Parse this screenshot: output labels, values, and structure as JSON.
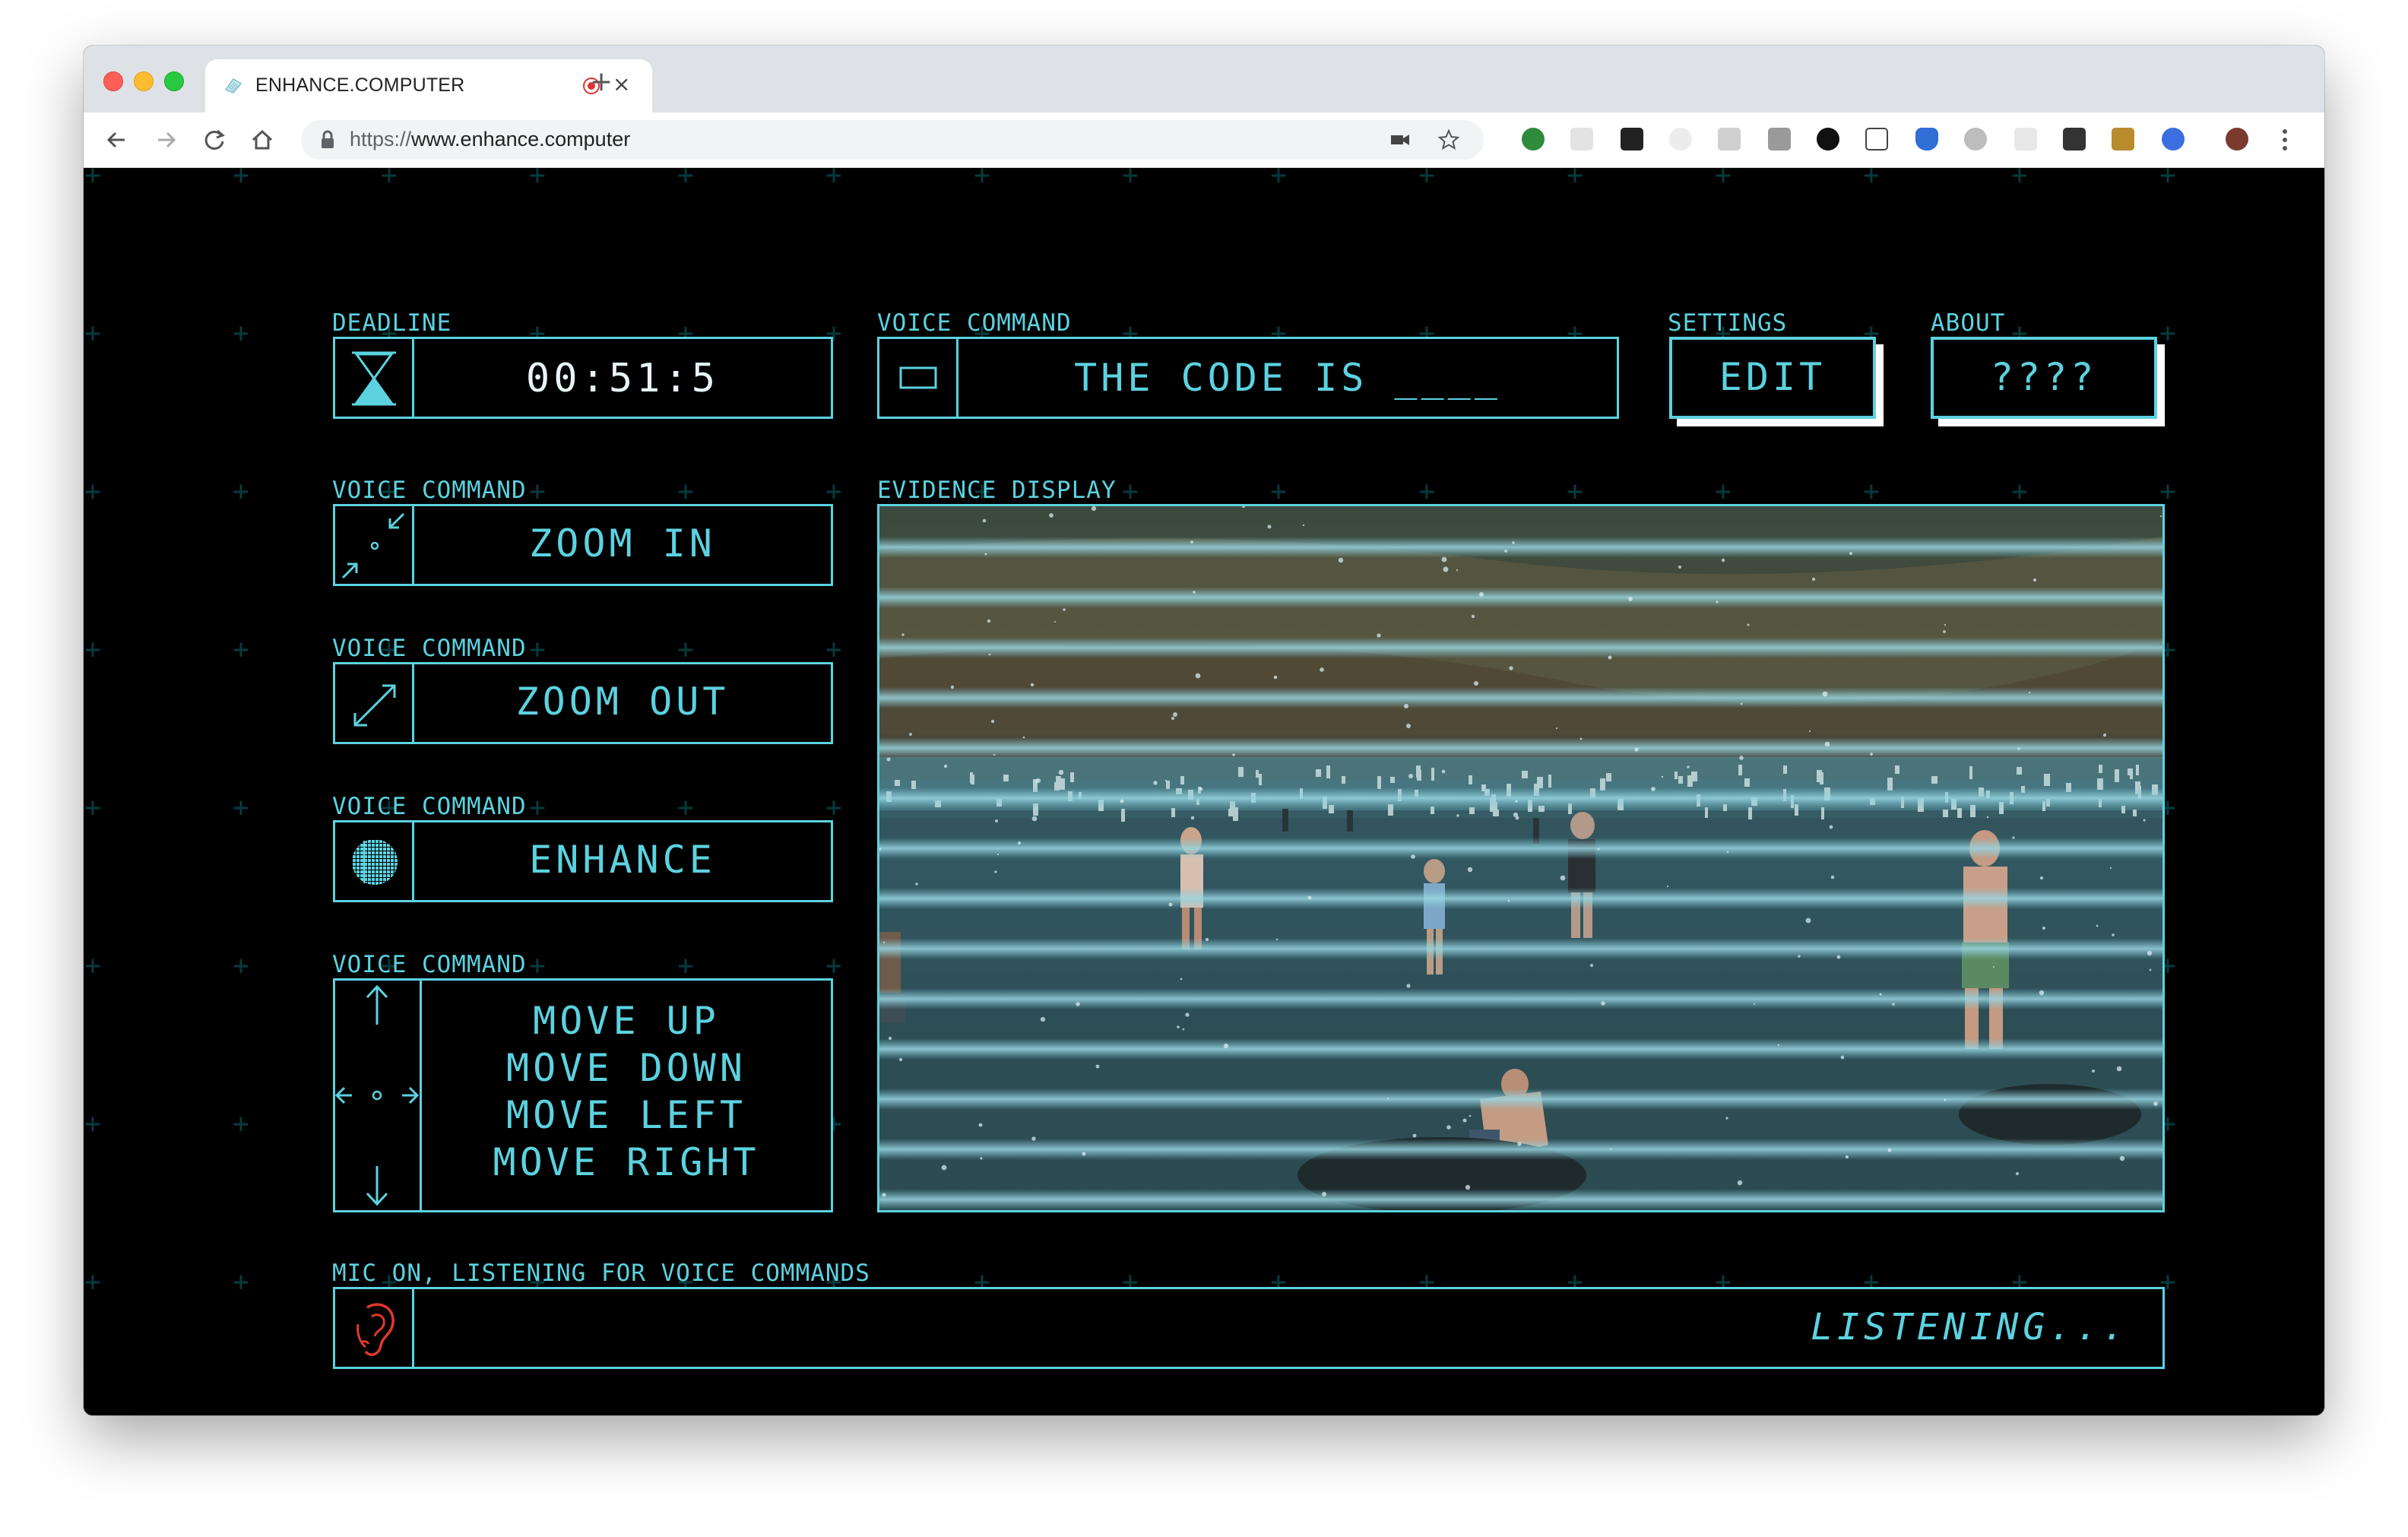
{
  "browser": {
    "tab_title": "ENHANCE.COMPUTER",
    "url_scheme": "https://",
    "url_host": "www.enhance.computer",
    "new_tab_label": "+",
    "close_tab_label": "×"
  },
  "deadline": {
    "label": "DEADLINE",
    "value": "00:51:5"
  },
  "code_command": {
    "label": "VOICE COMMAND",
    "value": "THE CODE IS ____"
  },
  "settings": {
    "label": "SETTINGS",
    "button": "EDIT"
  },
  "about": {
    "label": "ABOUT",
    "button": "????"
  },
  "zoom_in": {
    "label": "VOICE COMMAND",
    "value": "ZOOM IN"
  },
  "zoom_out": {
    "label": "VOICE COMMAND",
    "value": "ZOOM OUT"
  },
  "enhance": {
    "label": "VOICE COMMAND",
    "value": "ENHANCE"
  },
  "move": {
    "label": "VOICE COMMAND",
    "lines": [
      "MOVE UP",
      "MOVE DOWN",
      "MOVE LEFT",
      "MOVE RIGHT"
    ]
  },
  "evidence": {
    "label": "EVIDENCE DISPLAY"
  },
  "mic": {
    "label": "MIC ON, LISTENING FOR VOICE COMMANDS",
    "status": "LISTENING..."
  },
  "colors": {
    "accent": "#5cd2e0",
    "background": "#000000",
    "mic_icon": "#e0392b"
  },
  "icons": [
    "hourglass-icon",
    "screen-rect-icon",
    "zoom-in-icon",
    "zoom-out-icon",
    "enhance-globe-icon",
    "move-arrows-icon",
    "ear-icon"
  ]
}
